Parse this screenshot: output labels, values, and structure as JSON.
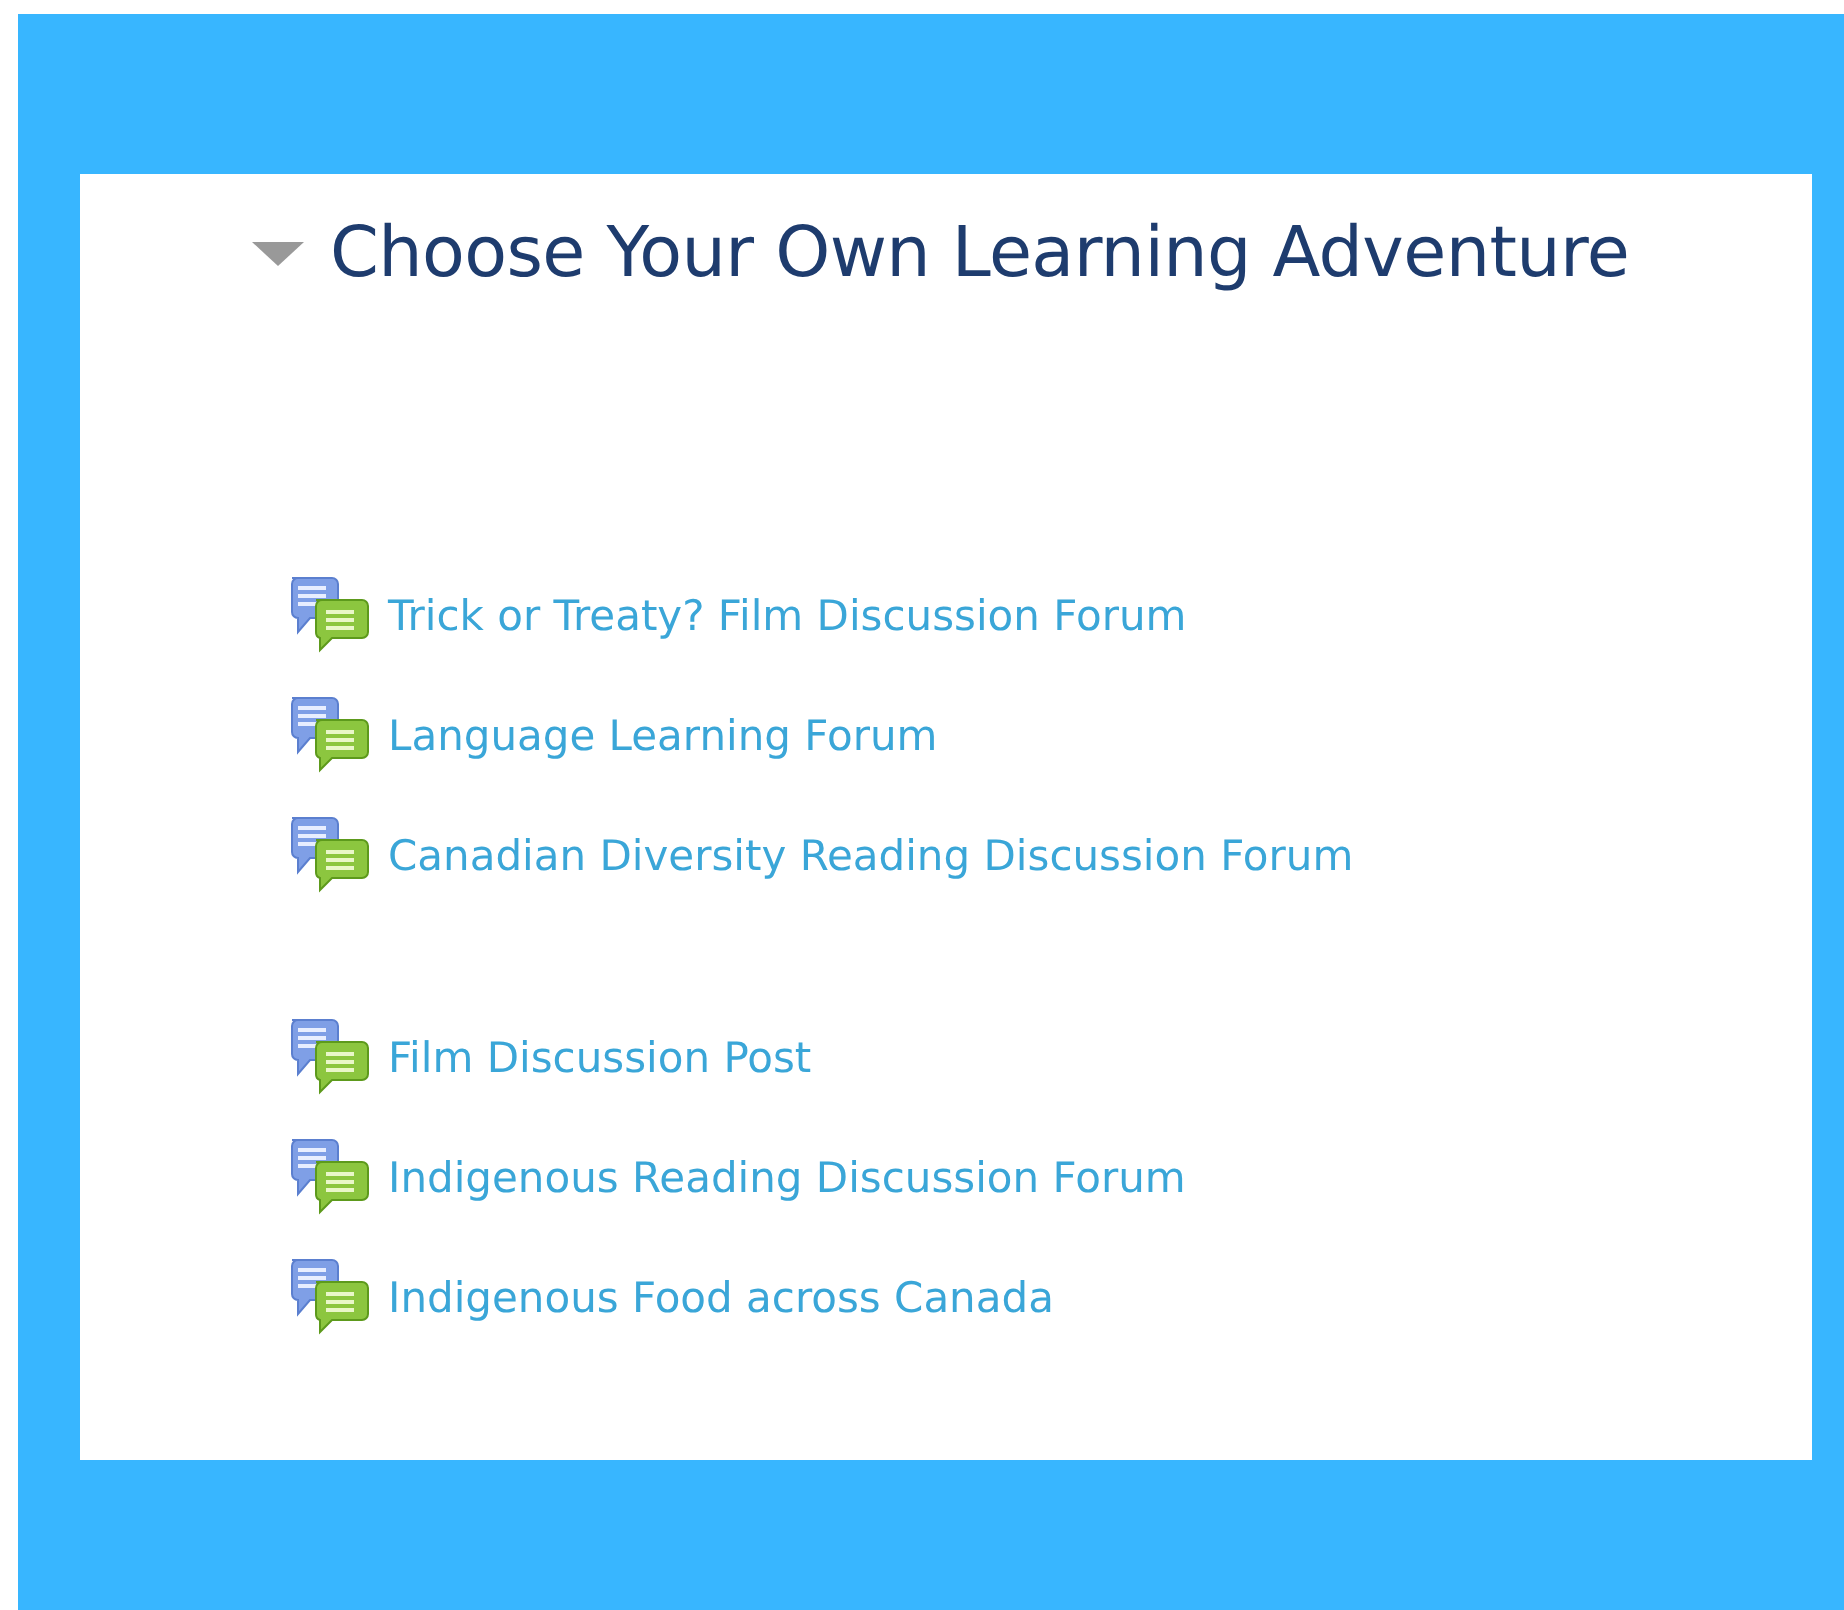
{
  "section": {
    "title": "Choose Your Own Learning Adventure",
    "expanded": true
  },
  "groups": [
    {
      "items": [
        {
          "label": "Trick or Treaty? Film Discussion Forum"
        },
        {
          "label": "Language Learning Forum"
        },
        {
          "label": "Canadian Diversity Reading Discussion Forum"
        }
      ]
    },
    {
      "items": [
        {
          "label": "Film Discussion Post"
        },
        {
          "label": "Indigenous Reading Discussion Forum"
        },
        {
          "label": "Indigenous Food across Canada"
        }
      ]
    }
  ]
}
